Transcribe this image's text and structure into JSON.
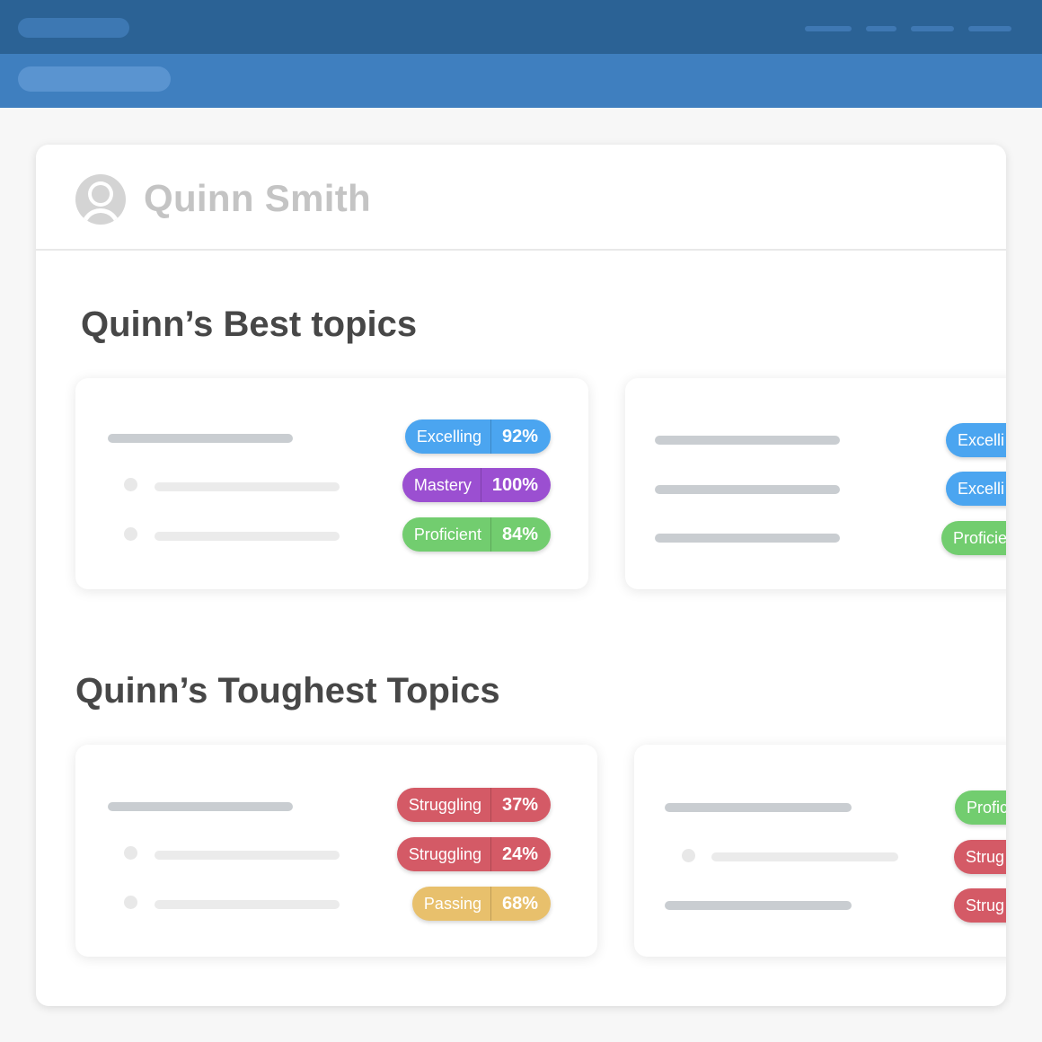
{
  "student": {
    "name": "Quinn Smith"
  },
  "sections": {
    "best_title": "Quinn’s Best topics",
    "toughest_title": "Quinn’s Toughest Topics"
  },
  "colors": {
    "excelling": "#4ba5f0",
    "mastery": "#9b4fd1",
    "proficient": "#72cd6f",
    "struggling": "#d45a66",
    "passing": "#e8c06c"
  },
  "best_cards": [
    {
      "badges": [
        {
          "label": "Excelling",
          "percent": "92%",
          "status": "excelling"
        },
        {
          "label": "Mastery",
          "percent": "100%",
          "status": "mastery"
        },
        {
          "label": "Proficient",
          "percent": "84%",
          "status": "proficient"
        }
      ]
    },
    {
      "badges": [
        {
          "label": "Excelli",
          "status": "excelling"
        },
        {
          "label": "Excelli",
          "status": "excelling"
        },
        {
          "label": "Proficie",
          "status": "proficient"
        }
      ]
    }
  ],
  "toughest_cards": [
    {
      "badges": [
        {
          "label": "Struggling",
          "percent": "37%",
          "status": "struggling"
        },
        {
          "label": "Struggling",
          "percent": "24%",
          "status": "struggling"
        },
        {
          "label": "Passing",
          "percent": "68%",
          "status": "passing"
        }
      ]
    },
    {
      "badges": [
        {
          "label": "Profic",
          "status": "proficient"
        },
        {
          "label": "Strug",
          "status": "struggling"
        },
        {
          "label": "Strug",
          "status": "struggling"
        }
      ]
    }
  ]
}
